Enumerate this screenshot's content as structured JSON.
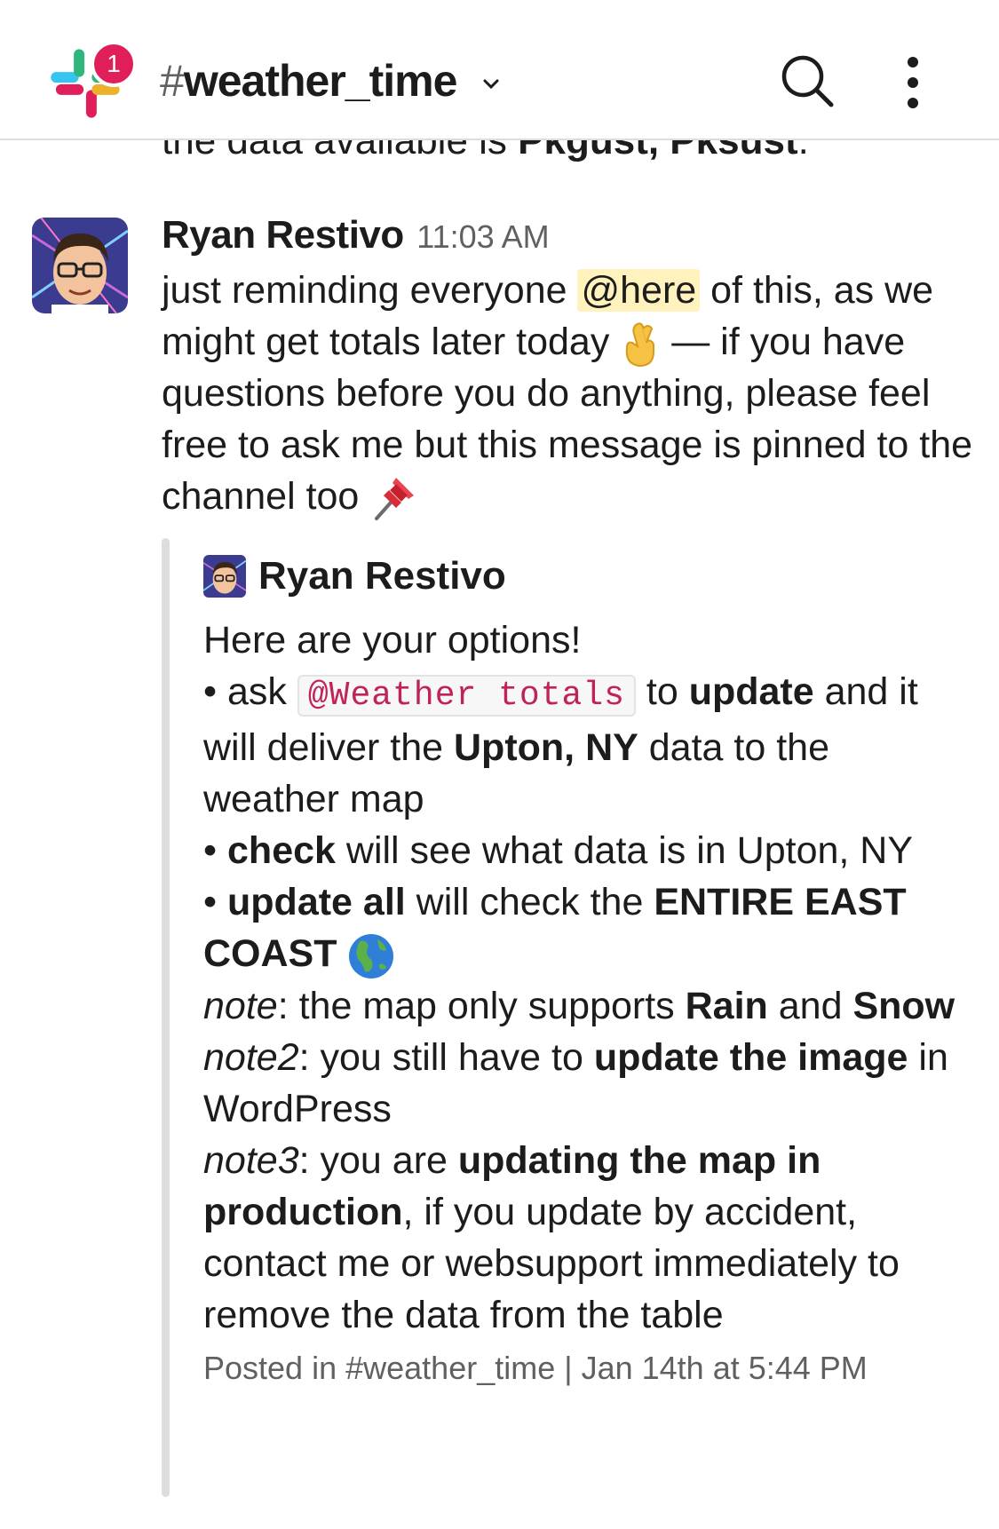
{
  "header": {
    "badge_count": "1",
    "channel_hash": "#",
    "channel_name": "weather_time",
    "icons": [
      "slack-logo-icon",
      "chevron-down-icon",
      "search-icon",
      "more-vertical-icon"
    ]
  },
  "previous_message": {
    "prefix": "the data available is ",
    "bold": "Pkgust, Pksust",
    "suffix": "."
  },
  "message": {
    "author": "Ryan Restivo",
    "time": "11:03 AM",
    "t1": "just reminding everyone ",
    "mention": "@here",
    "t2": " of this, as we might get totals later today ",
    "emoji1": "crossed-fingers",
    "t3": " — if you have questions before you do anything, please feel free to ask me but this message is pinned to the channel too ",
    "emoji2": "pushpin"
  },
  "attachment": {
    "author": "Ryan Restivo",
    "line1": "Here are your options!",
    "b1_pre": "• ask ",
    "b1_code": "@Weather totals",
    "b1_mid": " to ",
    "b1_bold": "update",
    "b1_mid2": " and it will deliver the ",
    "b1_bold2": "Upton, NY",
    "b1_end": " data to the weather map",
    "b2_pre": "• ",
    "b2_bold": "check",
    "b2_end": " will see what data is in Upton, NY",
    "b3_pre": "• ",
    "b3_bold": "update all",
    "b3_mid": " will check the ",
    "b3_bold2": "ENTIRE EAST COAST",
    "b3_emoji": "earth-americas",
    "n1_label": "note",
    "n1_mid": ": the map only supports ",
    "n1_b1": "Rain",
    "n1_and": " and ",
    "n1_b2": "Snow",
    "n2_label": "note2",
    "n2_mid": ": you still have to ",
    "n2_bold": "update the image",
    "n2_end": " in WordPress",
    "n3_label": "note3",
    "n3_mid": ": you are ",
    "n3_bold": "updating the map in production",
    "n3_end": ", if you update by accident, contact me or websupport immediately to remove the data from the table",
    "posted": "Posted in #weather_time | Jan 14th at 5:44 PM"
  },
  "colors": {
    "badge": "#e01e5a",
    "mention_bg": "#fff2bd",
    "code_text": "#c0235b",
    "attachment_bar": "#dddddd"
  }
}
